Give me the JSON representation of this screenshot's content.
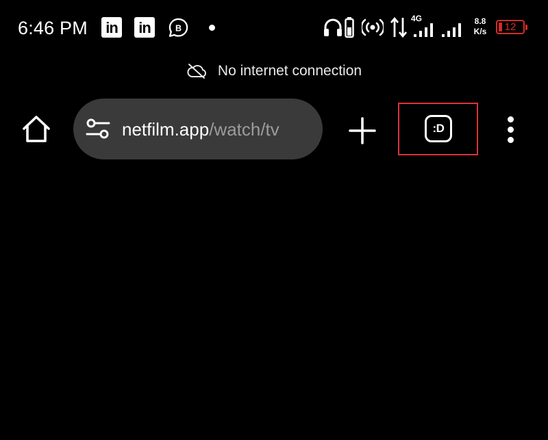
{
  "status_bar": {
    "time": "6:46 PM",
    "notifications": [
      {
        "icon": "linkedin-icon",
        "label": "in"
      },
      {
        "icon": "linkedin-icon",
        "label": "in"
      },
      {
        "icon": "whatsapp-business-icon",
        "label": "B"
      },
      {
        "icon": "more-notifications-dot-icon"
      }
    ],
    "network_type": "4G",
    "speed_value": "8.8",
    "speed_unit": "K/s",
    "battery_percent": "12",
    "battery_color": "#d32b2b"
  },
  "banner": {
    "icon": "cloud-off-icon",
    "text": "No internet connection"
  },
  "toolbar": {
    "home_icon": "home-icon",
    "url_host": "netfilm.app",
    "url_path": "/watch/tv",
    "site_settings_icon": "tune-icon",
    "new_tab_icon": "plus-icon",
    "tab_switcher_label": ":D",
    "menu_icon": "more-vert-icon",
    "highlight_color": "#d9343a"
  },
  "theme": {
    "background": "#000000",
    "omnibox_background": "#3a3a3a",
    "text_primary": "#ffffff",
    "text_secondary": "#9c9c9c"
  }
}
